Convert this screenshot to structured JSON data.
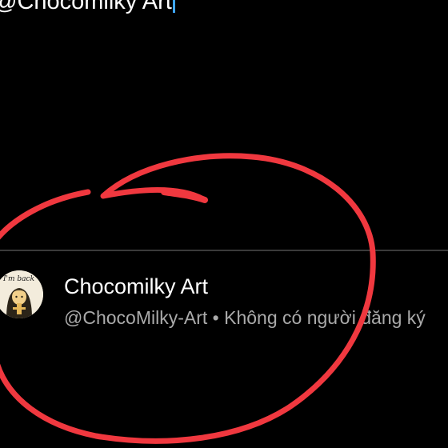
{
  "search": {
    "query": "@Chocomilky Art"
  },
  "result": {
    "channel_name": "Chocomilky Art",
    "handle": "@ChocoMilky-Art",
    "separator": "•",
    "subscribers": "Không có người đăng ký",
    "avatar": {
      "icon": "cartoon-avatar-icon",
      "caption": "I'm back"
    }
  },
  "colors": {
    "background": "#000000",
    "caret": "#3ea6ff",
    "meta_text": "#aaaaaa",
    "annotation_stroke": "#f0383f"
  }
}
